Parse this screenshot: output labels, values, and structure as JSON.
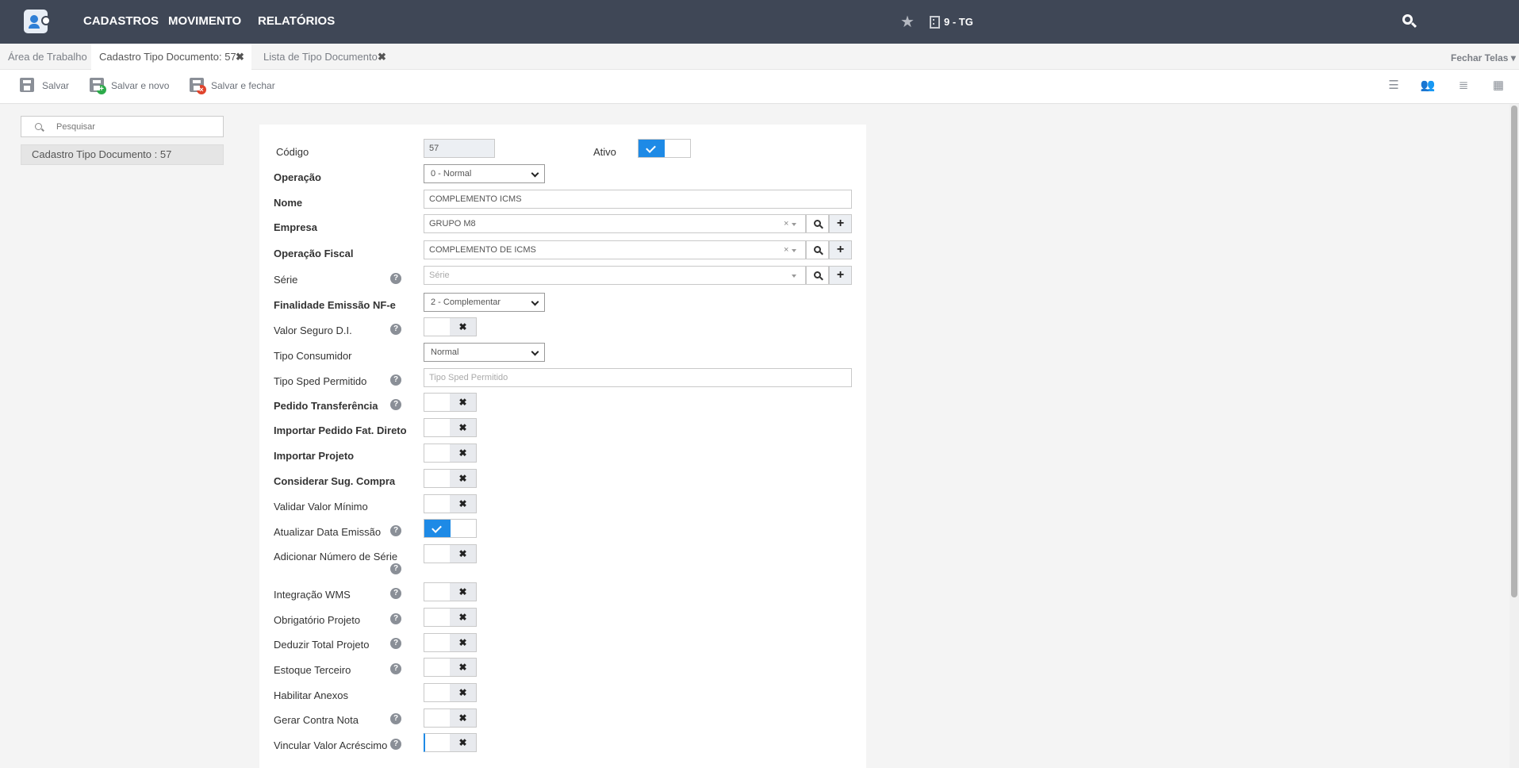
{
  "topbar": {
    "menu": [
      "CADASTROS",
      "MOVIMENTO",
      "RELATÓRIOS"
    ],
    "company": "9 - TG"
  },
  "tabs": [
    {
      "label": "Área de Trabalho"
    },
    {
      "label": "Cadastro Tipo Documento: 57",
      "closable": true
    },
    {
      "label": "Lista de Tipo Documento",
      "closable": true
    }
  ],
  "tabs_close_glyph": "✖",
  "fechar_telas": "Fechar Telas",
  "toolbar": {
    "salvar": "Salvar",
    "salvar_novo": "Salvar e novo",
    "salvar_fechar": "Salvar e fechar"
  },
  "sidebar": {
    "search_placeholder": "Pesquisar",
    "item": "Cadastro Tipo Documento : 57"
  },
  "form": {
    "codigo": {
      "label": "Código",
      "value": "57"
    },
    "ativo": {
      "label": "Ativo",
      "on": true
    },
    "operacao": {
      "label": "Operação",
      "value": "0 - Normal"
    },
    "nome": {
      "label": "Nome",
      "value": "COMPLEMENTO ICMS"
    },
    "empresa": {
      "label": "Empresa",
      "value": "GRUPO M8"
    },
    "operacao_fiscal": {
      "label": "Operação Fiscal",
      "value": "COMPLEMENTO DE ICMS"
    },
    "serie": {
      "label": "Série",
      "placeholder": "Série"
    },
    "finalidade": {
      "label": "Finalidade Emissão NF-e",
      "value": "2 - Complementar"
    },
    "valor_seguro": {
      "label": "Valor Seguro D.I.",
      "on": false
    },
    "tipo_consumidor": {
      "label": "Tipo Consumidor",
      "value": "Normal"
    },
    "tipo_sped": {
      "label": "Tipo Sped Permitido",
      "placeholder": "Tipo Sped Permitido"
    },
    "toggles": [
      {
        "label": "Pedido Transferência",
        "on": false
      },
      {
        "label": "Importar Pedido Fat. Direto",
        "on": false
      },
      {
        "label": "Importar Projeto",
        "on": false
      },
      {
        "label": "Considerar Sug. Compra",
        "on": false
      },
      {
        "label": "Validar Valor Mínimo",
        "on": false
      },
      {
        "label": "Atualizar Data Emissão",
        "on": true
      },
      {
        "label": "Adicionar Número de Série",
        "on": false
      },
      {
        "label": "Integração WMS",
        "on": false
      },
      {
        "label": "Obrigatório Projeto",
        "on": false
      },
      {
        "label": "Deduzir Total Projeto",
        "on": false
      },
      {
        "label": "Estoque Terceiro",
        "on": false
      },
      {
        "label": "Habilitar Anexos",
        "on": false
      },
      {
        "label": "Gerar Contra Nota",
        "on": false
      },
      {
        "label": "Vincular Valor Acréscimo",
        "on": false
      }
    ]
  },
  "icons": {
    "help": "?",
    "clear": "×",
    "add": "+",
    "off": "✖"
  }
}
